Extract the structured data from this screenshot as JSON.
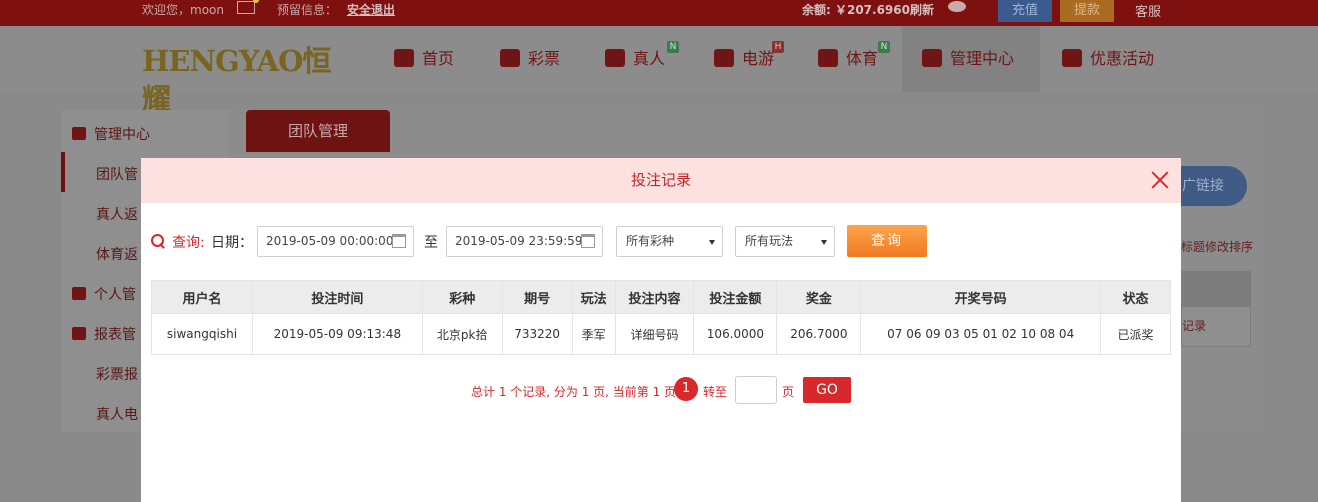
{
  "topbar": {
    "welcome": "欢迎您，moon",
    "notice_label": "预留信息：",
    "logout": "安全退出",
    "balance": "余额: ￥207.6960",
    "refresh": "刷新",
    "recharge": "充值",
    "withdraw": "提款",
    "service": "客服"
  },
  "nav": {
    "logo": "HENGYAO恒耀",
    "items": [
      {
        "label": "首页",
        "badge": ""
      },
      {
        "label": "彩票",
        "badge": ""
      },
      {
        "label": "真人",
        "badge": "N"
      },
      {
        "label": "电游",
        "badge": "H"
      },
      {
        "label": "体育",
        "badge": "N"
      },
      {
        "label": "管理中心",
        "badge": ""
      },
      {
        "label": "优惠活动",
        "badge": ""
      }
    ]
  },
  "sidebar": {
    "head1": "管理中心",
    "item1": "团队管",
    "item2": "真人返",
    "item3": "体育返",
    "head2": "个人管",
    "head3": "报表管",
    "item4": "彩票报",
    "item5": "真人电"
  },
  "page": {
    "tab": "团队管理",
    "promo": "广链接",
    "sort_tip": "标题修改排序",
    "record_link": "记录"
  },
  "modal": {
    "title": "投注记录",
    "query_label": "查询:",
    "date_label": "日期：",
    "date_from": "2019-05-09 00:00:00",
    "to_label": "至",
    "date_to": "2019-05-09 23:59:59",
    "lottery_select": "所有彩种",
    "play_select": "所有玩法",
    "query_button": "查询",
    "table": {
      "headers": [
        "用户名",
        "投注时间",
        "彩种",
        "期号",
        "玩法",
        "投注内容",
        "投注金额",
        "奖金",
        "开奖号码",
        "状态"
      ],
      "rows": [
        [
          "siwangqishi",
          "2019-05-09 09:13:48",
          "北京pk拾",
          "733220",
          "季军",
          "详细号码",
          "106.0000",
          "206.7000",
          "07 06 09 03 05 01 02 10 08 04",
          "已派奖"
        ]
      ]
    },
    "pager": {
      "summary": "总计 1 个记录, 分为 1 页, 当前第 1 页",
      "current_page": "1",
      "goto_label": "转至",
      "page_unit": "页",
      "go_button": "GO"
    }
  }
}
